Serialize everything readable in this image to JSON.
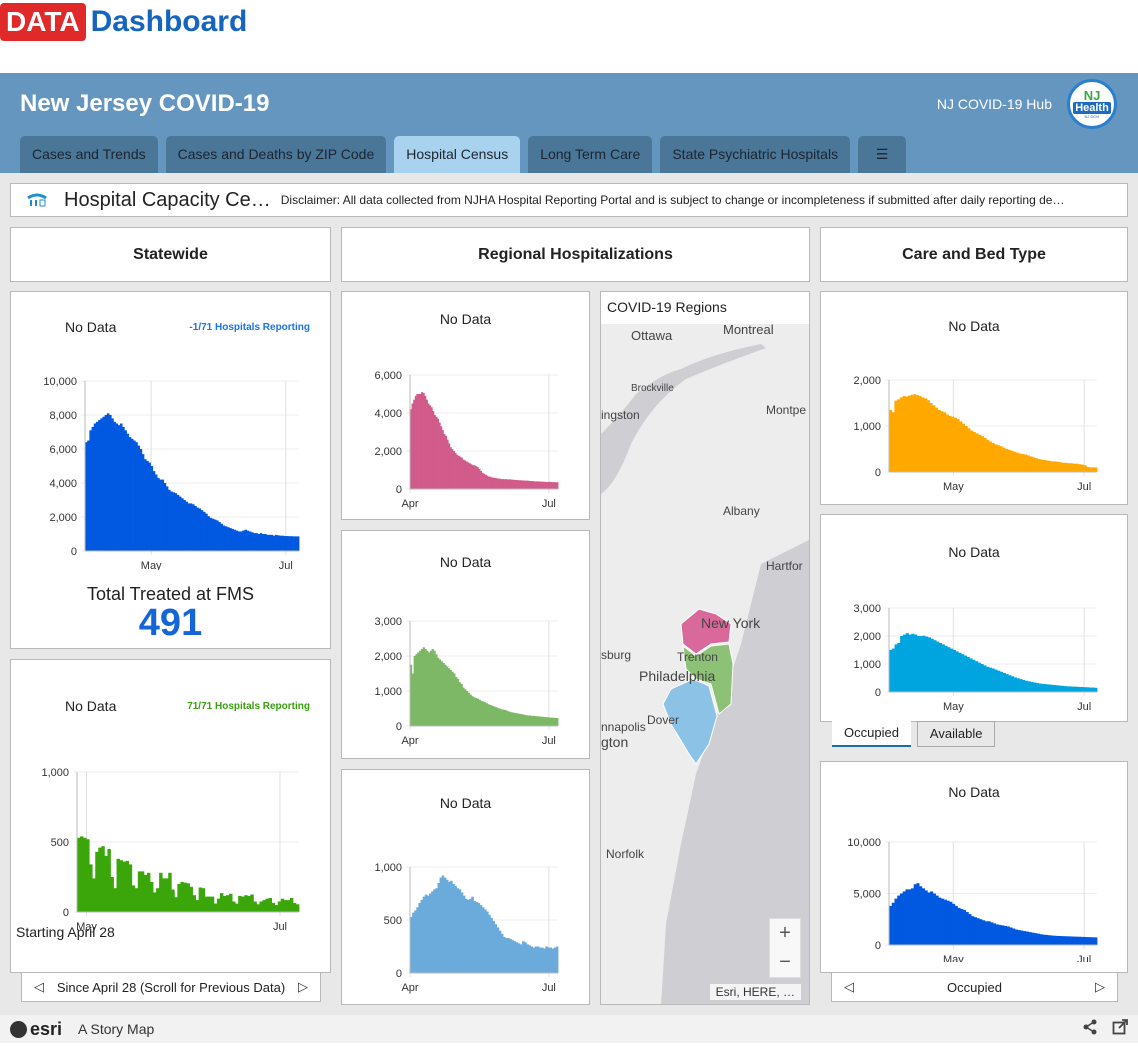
{
  "brand": {
    "data_label": "DATA",
    "dashboard_label": "Dashboard"
  },
  "header": {
    "title": "New Jersey COVID-19",
    "hub_link": "NJ COVID-19 Hub",
    "logo": {
      "line1": "NJ",
      "line2": "Health",
      "line3": "New Jersey Department of Health"
    }
  },
  "tabs": [
    {
      "label": "Cases and Trends",
      "active": false
    },
    {
      "label": "Cases and Deaths by ZIP Code",
      "active": false
    },
    {
      "label": "Hospital Census",
      "active": true
    },
    {
      "label": "Long Term Care",
      "active": false
    },
    {
      "label": "State Psychiatric Hospitals",
      "active": false
    },
    {
      "label": "☰",
      "icon": "list-icon",
      "active": false
    }
  ],
  "infobar": {
    "icon": "hospital-icon",
    "title": "Hospital Capacity Ce…",
    "disclaimer": "Disclaimer: All data collected from NJHA Hospital Reporting Portal and is subject to change or incompleteness if submitted after daily reporting de…"
  },
  "sections": {
    "statewide": "Statewide",
    "regional": "Regional Hospitalizations",
    "care": "Care and Bed Type"
  },
  "statewide": {
    "chart1": {
      "no_data": "No Data",
      "reporting": "-1/71 Hospitals Reporting",
      "reporting_color": "#1a73e8"
    },
    "fms_label": "Total Treated at FMS",
    "fms_value": "491",
    "chart2": {
      "no_data": "No Data",
      "reporting": "71/71 Hospitals Reporting",
      "reporting_color": "#3aa010"
    },
    "starting_label": "Starting April 28",
    "pager_label": "Since April 28 (Scroll for Previous Data)"
  },
  "regional": {
    "no_data": "No Data"
  },
  "map": {
    "title": "COVID-19 Regions",
    "labels": [
      "Ottawa",
      "Montreal",
      "Brockville",
      "ingston",
      "Montpe",
      "Albany",
      "Hartfor",
      "New York",
      "sburg",
      "Trenton",
      "Philadelphia",
      "Dover",
      "nnapolis",
      "gton",
      "Norfolk"
    ],
    "zoom_in": "+",
    "zoom_out": "−",
    "attribution": "Esri, HERE, …"
  },
  "care": {
    "no_data": "No Data",
    "subtabs": [
      "Occupied",
      "Available"
    ],
    "pager_label": "Occupied"
  },
  "footer": {
    "esri": "esri",
    "story": "A Story Map",
    "share_icon": "share-icon",
    "open_icon": "external-link-icon"
  },
  "chart_data": [
    {
      "id": "statewide-hospitalized",
      "type": "area",
      "color": "#0059e0",
      "title": "No Data",
      "xlabel": "",
      "ylabel": "",
      "ylim": [
        0,
        10000
      ],
      "yticks": [
        0,
        2000,
        4000,
        6000,
        8000,
        10000
      ],
      "ytick_labels": [
        "0",
        "2,000",
        "4,000",
        "6,000",
        "8,000",
        "10,000"
      ],
      "x_start": "2020-04-01",
      "x_end": "2020-07-07",
      "xticks": [
        {
          "date": "2020-05-01",
          "label": "May"
        },
        {
          "date": "2020-07-01",
          "label": "Jul"
        }
      ],
      "values": [
        6400,
        6500,
        7100,
        7300,
        7500,
        7600,
        7700,
        7800,
        7900,
        8000,
        8100,
        8000,
        7800,
        7600,
        7500,
        7400,
        7500,
        7300,
        7100,
        6900,
        6700,
        6600,
        6500,
        6400,
        6200,
        6000,
        5700,
        5400,
        5300,
        5200,
        5000,
        4700,
        4500,
        4300,
        4200,
        4200,
        4000,
        3800,
        3600,
        3500,
        3450,
        3400,
        3300,
        3200,
        3100,
        3000,
        2900,
        2800,
        2800,
        2750,
        2650,
        2550,
        2500,
        2400,
        2300,
        2200,
        2050,
        1950,
        1900,
        1850,
        1800,
        1700,
        1600,
        1500,
        1450,
        1400,
        1350,
        1300,
        1250,
        1200,
        1150,
        1150,
        1200,
        1250,
        1200,
        1150,
        1100,
        1050,
        1050,
        1000,
        1050,
        1000,
        1000,
        950,
        950,
        950,
        900,
        950,
        920,
        900,
        900,
        880,
        880,
        870,
        870,
        860,
        860,
        860
      ]
    },
    {
      "id": "statewide-fms",
      "type": "bar",
      "color": "#3aa60a",
      "title": "No Data",
      "ylim": [
        0,
        1000
      ],
      "yticks": [
        0,
        500,
        1000
      ],
      "ytick_labels": [
        "0",
        "500",
        "1,000"
      ],
      "x_start": "2020-04-28",
      "x_end": "2020-07-07",
      "xticks": [
        {
          "date": "2020-05-01",
          "label": "May"
        },
        {
          "date": "2020-07-01",
          "label": "Jul"
        }
      ],
      "values": [
        530,
        540,
        530,
        520,
        340,
        240,
        430,
        460,
        470,
        400,
        450,
        250,
        170,
        380,
        370,
        360,
        365,
        340,
        190,
        170,
        290,
        290,
        265,
        280,
        215,
        140,
        170,
        280,
        240,
        240,
        280,
        160,
        105,
        200,
        215,
        210,
        205,
        180,
        120,
        85,
        175,
        170,
        110,
        110,
        110,
        60,
        95,
        135,
        115,
        120,
        130,
        75,
        60,
        115,
        110,
        120,
        115,
        125,
        75,
        55,
        75,
        85,
        95,
        100,
        65,
        50,
        75,
        95,
        85,
        85,
        100,
        65,
        55
      ]
    },
    {
      "id": "region-north",
      "type": "area",
      "color": "#d15b8b",
      "title": "No Data",
      "ylim": [
        0,
        6000
      ],
      "yticks": [
        0,
        2000,
        4000,
        6000
      ],
      "ytick_labels": [
        "0",
        "2,000",
        "4,000",
        "6,000"
      ],
      "x_start": "2020-04-01",
      "x_end": "2020-07-07",
      "xticks": [
        {
          "date": "2020-04-01",
          "label": "Apr"
        },
        {
          "date": "2020-07-01",
          "label": "Jul"
        }
      ],
      "values": [
        4200,
        4500,
        4700,
        4900,
        5000,
        5000,
        5000,
        5100,
        5050,
        4900,
        4700,
        4500,
        4400,
        4300,
        4100,
        3900,
        3800,
        3700,
        3500,
        3300,
        3100,
        2900,
        2800,
        2600,
        2400,
        2200,
        2100,
        2000,
        1900,
        1800,
        1750,
        1700,
        1650,
        1550,
        1500,
        1450,
        1400,
        1350,
        1300,
        1250,
        1250,
        1200,
        1150,
        1050,
        950,
        850,
        800,
        750,
        700,
        650,
        650,
        600,
        600,
        580,
        560,
        550,
        540,
        520,
        520,
        510,
        520,
        500,
        510,
        500,
        490,
        480,
        470,
        470,
        460,
        460,
        450,
        450,
        440,
        440,
        430,
        420,
        420,
        410,
        400,
        400,
        400,
        390,
        390,
        380,
        380,
        370,
        370,
        380,
        370,
        360,
        360,
        350,
        360
      ]
    },
    {
      "id": "region-central",
      "type": "area",
      "color": "#7cb866",
      "title": "No Data",
      "ylim": [
        0,
        3000
      ],
      "yticks": [
        0,
        1000,
        2000,
        3000
      ],
      "ytick_labels": [
        "0",
        "1,000",
        "2,000",
        "3,000"
      ],
      "x_start": "2020-04-01",
      "x_end": "2020-07-07",
      "xticks": [
        {
          "date": "2020-04-01",
          "label": "Apr"
        },
        {
          "date": "2020-07-01",
          "label": "Jul"
        }
      ],
      "values": [
        1750,
        1500,
        2000,
        2050,
        2100,
        2150,
        2200,
        2250,
        2200,
        2150,
        2100,
        2150,
        2200,
        2150,
        2050,
        1950,
        1900,
        1850,
        1800,
        1750,
        1700,
        1650,
        1600,
        1550,
        1500,
        1400,
        1350,
        1250,
        1200,
        1100,
        1050,
        1000,
        950,
        900,
        850,
        820,
        800,
        780,
        750,
        720,
        700,
        680,
        650,
        620,
        600,
        580,
        560,
        540,
        520,
        500,
        480,
        470,
        460,
        440,
        420,
        400,
        390,
        380,
        370,
        360,
        350,
        340,
        330,
        320,
        310,
        300,
        300,
        290,
        290,
        280,
        280,
        270,
        270,
        260,
        260,
        250,
        250,
        240,
        240,
        235,
        230,
        230
      ]
    },
    {
      "id": "region-south",
      "type": "area",
      "color": "#6aabdc",
      "title": "No Data",
      "ylim": [
        0,
        1000
      ],
      "yticks": [
        0,
        500,
        1000
      ],
      "ytick_labels": [
        "0",
        "500",
        "1,000"
      ],
      "x_start": "2020-04-01",
      "x_end": "2020-07-07",
      "xticks": [
        {
          "date": "2020-04-01",
          "label": "Apr"
        },
        {
          "date": "2020-07-01",
          "label": "Jul"
        }
      ],
      "values": [
        530,
        570,
        590,
        620,
        660,
        690,
        720,
        740,
        730,
        750,
        770,
        790,
        800,
        850,
        900,
        920,
        900,
        880,
        860,
        870,
        840,
        820,
        800,
        790,
        760,
        730,
        700,
        690,
        700,
        720,
        680,
        670,
        660,
        640,
        620,
        600,
        580,
        550,
        520,
        490,
        460,
        430,
        400,
        370,
        340,
        330,
        330,
        320,
        310,
        300,
        290,
        280,
        270,
        300,
        290,
        270,
        260,
        250,
        240,
        250,
        250,
        240,
        240,
        230,
        250,
        240,
        240,
        230,
        240,
        250
      ]
    },
    {
      "id": "care-icu",
      "type": "area",
      "color": "#ffa800",
      "title": "No Data",
      "ylim": [
        0,
        2000
      ],
      "yticks": [
        0,
        1000,
        2000
      ],
      "ytick_labels": [
        "0",
        "1,000",
        "2,000"
      ],
      "x_start": "2020-04-01",
      "x_end": "2020-07-07",
      "xticks": [
        {
          "date": "2020-05-01",
          "label": "May"
        },
        {
          "date": "2020-07-01",
          "label": "Jul"
        }
      ],
      "values": [
        1350,
        1300,
        1550,
        1580,
        1620,
        1650,
        1640,
        1660,
        1680,
        1690,
        1670,
        1650,
        1620,
        1600,
        1560,
        1500,
        1450,
        1400,
        1350,
        1320,
        1300,
        1250,
        1220,
        1200,
        1180,
        1150,
        1100,
        1050,
        1000,
        950,
        900,
        870,
        840,
        810,
        780,
        740,
        700,
        660,
        630,
        600,
        580,
        560,
        530,
        500,
        480,
        460,
        440,
        420,
        400,
        390,
        380,
        360,
        340,
        320,
        300,
        280,
        270,
        260,
        250,
        240,
        230,
        230,
        220,
        210,
        200,
        200,
        190,
        190,
        180,
        180,
        170,
        160,
        150,
        110,
        100,
        100,
        100
      ]
    },
    {
      "id": "care-ventilator",
      "type": "area",
      "color": "#00a5e0",
      "title": "No Data",
      "ylim": [
        0,
        3000
      ],
      "yticks": [
        0,
        1000,
        2000,
        3000
      ],
      "ytick_labels": [
        "0",
        "1,000",
        "2,000",
        "3,000"
      ],
      "x_start": "2020-04-01",
      "x_end": "2020-07-07",
      "xticks": [
        {
          "date": "2020-05-01",
          "label": "May"
        },
        {
          "date": "2020-07-01",
          "label": "Jul"
        }
      ],
      "values": [
        1500,
        1550,
        1700,
        1750,
        2000,
        2050,
        2100,
        2050,
        2080,
        2050,
        2000,
        2000,
        2010,
        1980,
        1950,
        1900,
        1850,
        1800,
        1750,
        1700,
        1650,
        1600,
        1550,
        1500,
        1450,
        1400,
        1350,
        1300,
        1250,
        1200,
        1150,
        1100,
        1050,
        1000,
        950,
        900,
        870,
        840,
        800,
        760,
        720,
        680,
        640,
        600,
        560,
        520,
        490,
        460,
        430,
        400,
        380,
        360,
        340,
        320,
        300,
        290,
        280,
        270,
        260,
        250,
        240,
        230,
        220,
        210,
        200,
        200,
        190,
        190,
        180,
        180,
        170,
        170,
        160,
        160,
        150
      ]
    },
    {
      "id": "care-total-beds",
      "type": "area",
      "color": "#0059e0",
      "title": "No Data",
      "ylim": [
        0,
        10000
      ],
      "yticks": [
        0,
        5000,
        10000
      ],
      "ytick_labels": [
        "0",
        "5,000",
        "10,000"
      ],
      "x_start": "2020-04-01",
      "x_end": "2020-07-07",
      "xticks": [
        {
          "date": "2020-05-01",
          "label": "May"
        },
        {
          "date": "2020-07-01",
          "label": "Jul"
        }
      ],
      "values": [
        3800,
        4100,
        4500,
        4800,
        5000,
        5200,
        5400,
        5400,
        5500,
        5900,
        6000,
        5700,
        5500,
        5300,
        5100,
        5200,
        5000,
        4800,
        4600,
        4500,
        4400,
        4300,
        4200,
        4000,
        3800,
        3600,
        3500,
        3400,
        3200,
        3000,
        2800,
        2700,
        2600,
        2500,
        2400,
        2300,
        2300,
        2200,
        2100,
        2000,
        1950,
        1900,
        1850,
        1800,
        1700,
        1600,
        1500,
        1450,
        1400,
        1350,
        1300,
        1250,
        1200,
        1150,
        1100,
        1050,
        1000,
        980,
        950,
        920,
        900,
        880,
        870,
        860,
        850,
        840,
        830,
        820,
        810,
        800,
        790,
        780,
        770,
        760,
        750,
        740
      ]
    }
  ]
}
